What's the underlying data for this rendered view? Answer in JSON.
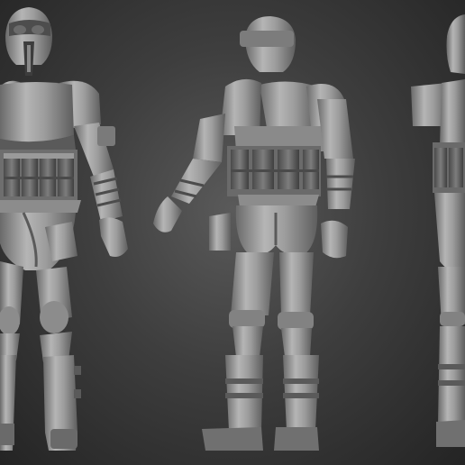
{
  "scene": {
    "background_color": "#3b3b3b",
    "model_color": "#9a9a9a",
    "views": [
      {
        "name": "front-view"
      },
      {
        "name": "back-view"
      },
      {
        "name": "side-view"
      }
    ]
  }
}
